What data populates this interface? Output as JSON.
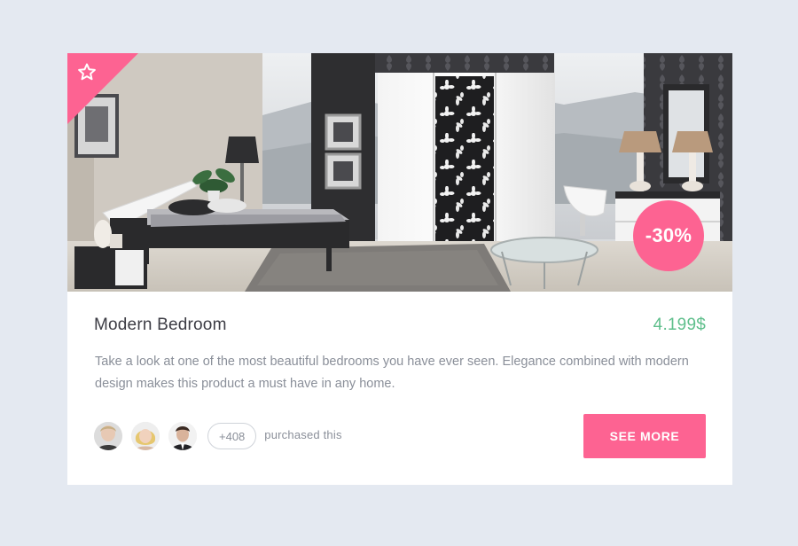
{
  "card": {
    "image_alt": "Modern bedroom interior",
    "favorite_icon": "star-outline-icon",
    "discount": "-30%",
    "title": "Modern Bedroom",
    "price": "4.199$",
    "description": "Take a look at one of the most beautiful bedrooms you have ever seen. Elegance combined with modern design makes this product a must have in any home.",
    "buyers": {
      "avatars": [
        "buyer-avatar-1",
        "buyer-avatar-2",
        "buyer-avatar-3"
      ],
      "extra_count": "+408",
      "label": "purchased this"
    },
    "cta_label": "SEE MORE"
  },
  "colors": {
    "background": "#e4e9f1",
    "accent_pink": "#fd6392",
    "price_green": "#5fbf8c",
    "title_text": "#3c3c44",
    "muted_text": "#8a8f99"
  }
}
